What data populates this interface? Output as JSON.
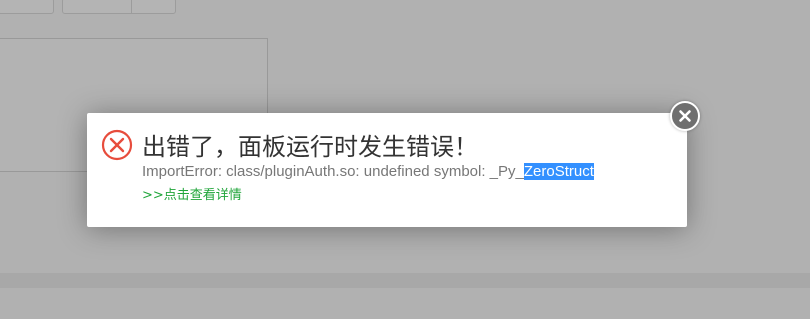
{
  "modal": {
    "title": "出错了，面板运行时发生错误！",
    "message_prefix": "ImportError: class/pluginAuth.so: undefined symbol: _Py_",
    "message_selected": "ZeroStruct",
    "detail_link": ">>点击查看详情",
    "icon": "error-circle-x-icon",
    "close_icon": "close-x-icon"
  },
  "colors": {
    "error_red": "#e74c3c",
    "link_green": "#20a53a",
    "selection_blue": "#3390ff",
    "overlay_gray": "#b1b1b1"
  }
}
